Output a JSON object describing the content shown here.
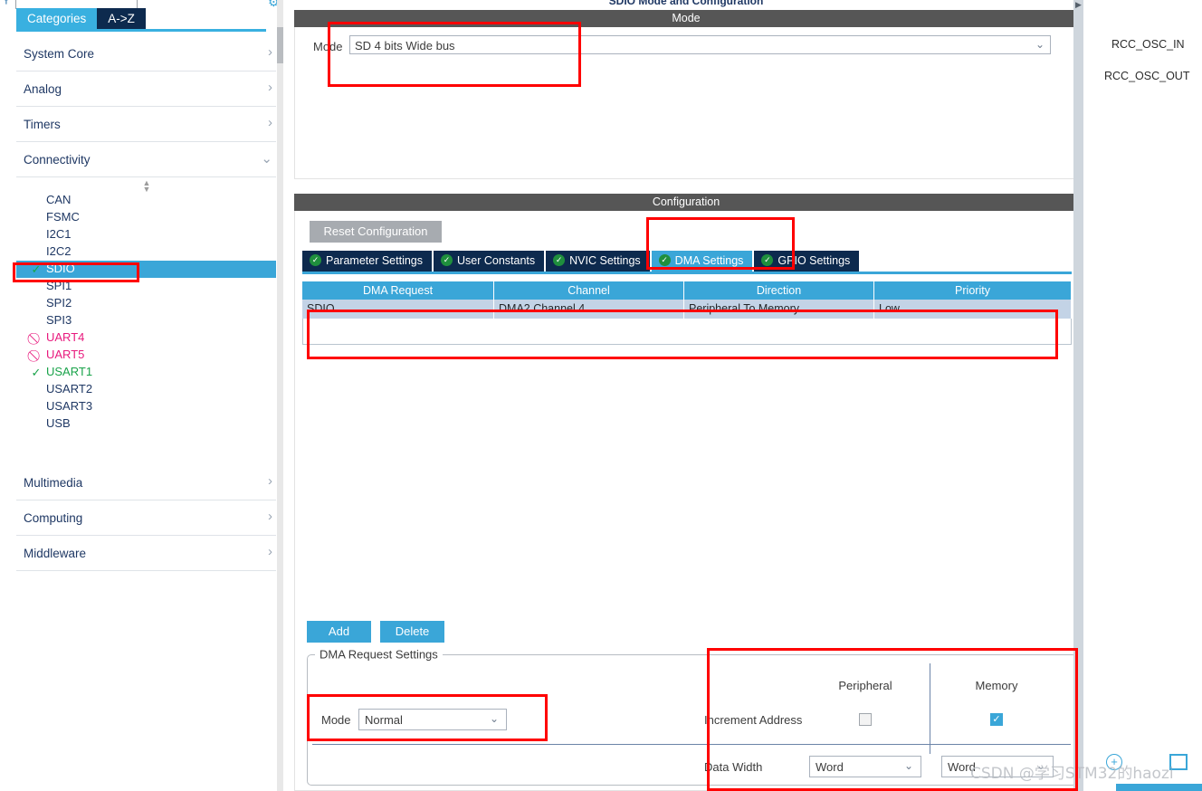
{
  "sidebar": {
    "search_placeholder": "",
    "search_value": "",
    "tabs": [
      {
        "label": "Categories",
        "active": true
      },
      {
        "label": "A->Z",
        "active": false
      }
    ],
    "categories_top": [
      {
        "label": "System Core",
        "chevron": "chevron-right"
      },
      {
        "label": "Analog",
        "chevron": "chevron-right"
      },
      {
        "label": "Timers",
        "chevron": "chevron-right"
      },
      {
        "label": "Connectivity",
        "chevron": "chevron-down"
      }
    ],
    "peripherals": [
      {
        "label": "CAN",
        "status": "none",
        "selected": false
      },
      {
        "label": "FSMC",
        "status": "none",
        "selected": false
      },
      {
        "label": "I2C1",
        "status": "none",
        "selected": false
      },
      {
        "label": "I2C2",
        "status": "none",
        "selected": false
      },
      {
        "label": "SDIO",
        "status": "ok-circle",
        "selected": true
      },
      {
        "label": "SPI1",
        "status": "none",
        "selected": false
      },
      {
        "label": "SPI2",
        "status": "none",
        "selected": false
      },
      {
        "label": "SPI3",
        "status": "none",
        "selected": false
      },
      {
        "label": "UART4",
        "status": "blocked",
        "selected": false
      },
      {
        "label": "UART5",
        "status": "blocked",
        "selected": false
      },
      {
        "label": "USART1",
        "status": "ok-check",
        "selected": false
      },
      {
        "label": "USART2",
        "status": "none",
        "selected": false
      },
      {
        "label": "USART3",
        "status": "none",
        "selected": false
      },
      {
        "label": "USB",
        "status": "none",
        "selected": false
      }
    ],
    "categories_bottom": [
      {
        "label": "Multimedia",
        "chevron": "chevron-right"
      },
      {
        "label": "Computing",
        "chevron": "chevron-right"
      },
      {
        "label": "Middleware",
        "chevron": "chevron-right"
      }
    ]
  },
  "center": {
    "pane_title": "SDIO Mode and Configuration",
    "mode_section": {
      "header": "Mode",
      "mode_label": "Mode",
      "mode_value": "SD 4 bits Wide bus"
    },
    "configuration_section": {
      "header": "Configuration",
      "reset_button": "Reset Configuration",
      "tabs": [
        {
          "label": "Parameter Settings",
          "active": false
        },
        {
          "label": "User Constants",
          "active": false
        },
        {
          "label": "NVIC Settings",
          "active": false
        },
        {
          "label": "DMA Settings",
          "active": true
        },
        {
          "label": "GPIO Settings",
          "active": false
        }
      ],
      "dma_table": {
        "columns": [
          "DMA Request",
          "Channel",
          "Direction",
          "Priority"
        ],
        "rows": [
          [
            "SDIO",
            "DMA2 Channel 4",
            "Peripheral To Memory",
            "Low"
          ]
        ]
      },
      "add_button": "Add",
      "delete_button": "Delete",
      "request_settings": {
        "legend": "DMA Request Settings",
        "mode_label": "Mode",
        "mode_value": "Normal",
        "col_peripheral": "Peripheral",
        "col_memory": "Memory",
        "increment_label": "Increment Address",
        "increment_peripheral_checked": false,
        "increment_memory_checked": true,
        "data_width_label": "Data Width",
        "data_width_peripheral": "Word",
        "data_width_memory": "Word"
      }
    }
  },
  "right_pane": {
    "pins": [
      "RCC_OSC_IN",
      "RCC_OSC_OUT"
    ],
    "zoom_in_icon": "zoom-in-icon",
    "fit_icon": "fit-to-screen-icon"
  },
  "watermark": "CSDN @学习STM32的haozi",
  "colors": {
    "accent_blue": "#3aa6d8",
    "tab_navy": "#0d2a4e",
    "section_header_grey": "#565656",
    "selected_row": "#c3d3e6",
    "annotation_red": "#ff0000",
    "status_green": "#19a34a",
    "status_pink": "#e8197d"
  }
}
